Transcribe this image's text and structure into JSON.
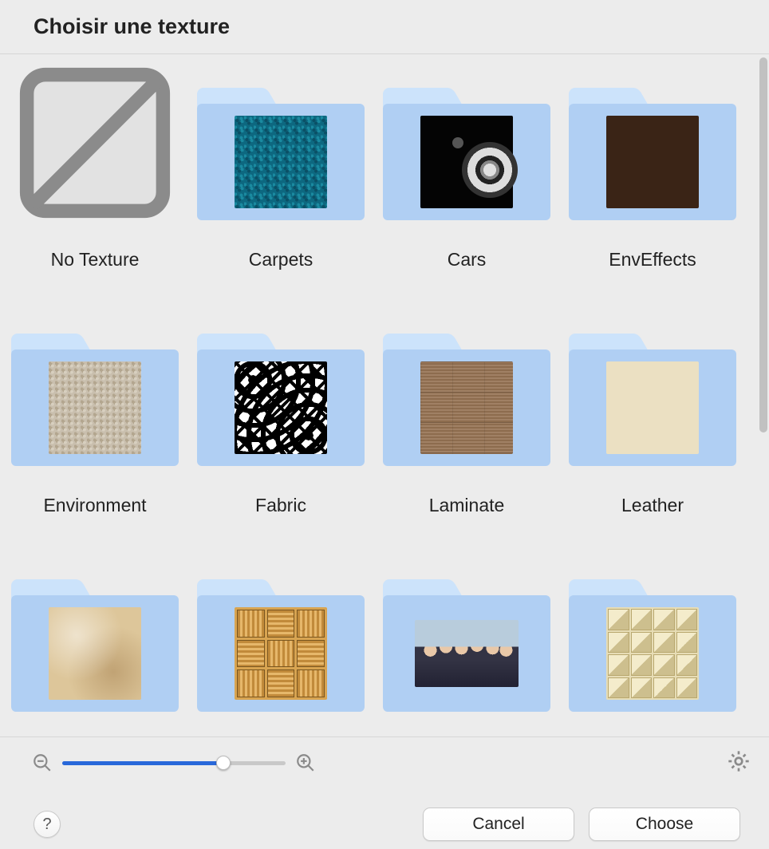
{
  "dialog": {
    "title": "Choisir une texture"
  },
  "items": [
    {
      "label": "No Texture"
    },
    {
      "label": "Carpets"
    },
    {
      "label": "Cars"
    },
    {
      "label": "EnvEffects"
    },
    {
      "label": "Environment"
    },
    {
      "label": "Fabric"
    },
    {
      "label": "Laminate"
    },
    {
      "label": "Leather"
    },
    {
      "label": ""
    },
    {
      "label": ""
    },
    {
      "label": ""
    },
    {
      "label": ""
    }
  ],
  "toolbar": {
    "slider_percent": 72
  },
  "buttons": {
    "help": "?",
    "cancel": "Cancel",
    "choose": "Choose"
  }
}
